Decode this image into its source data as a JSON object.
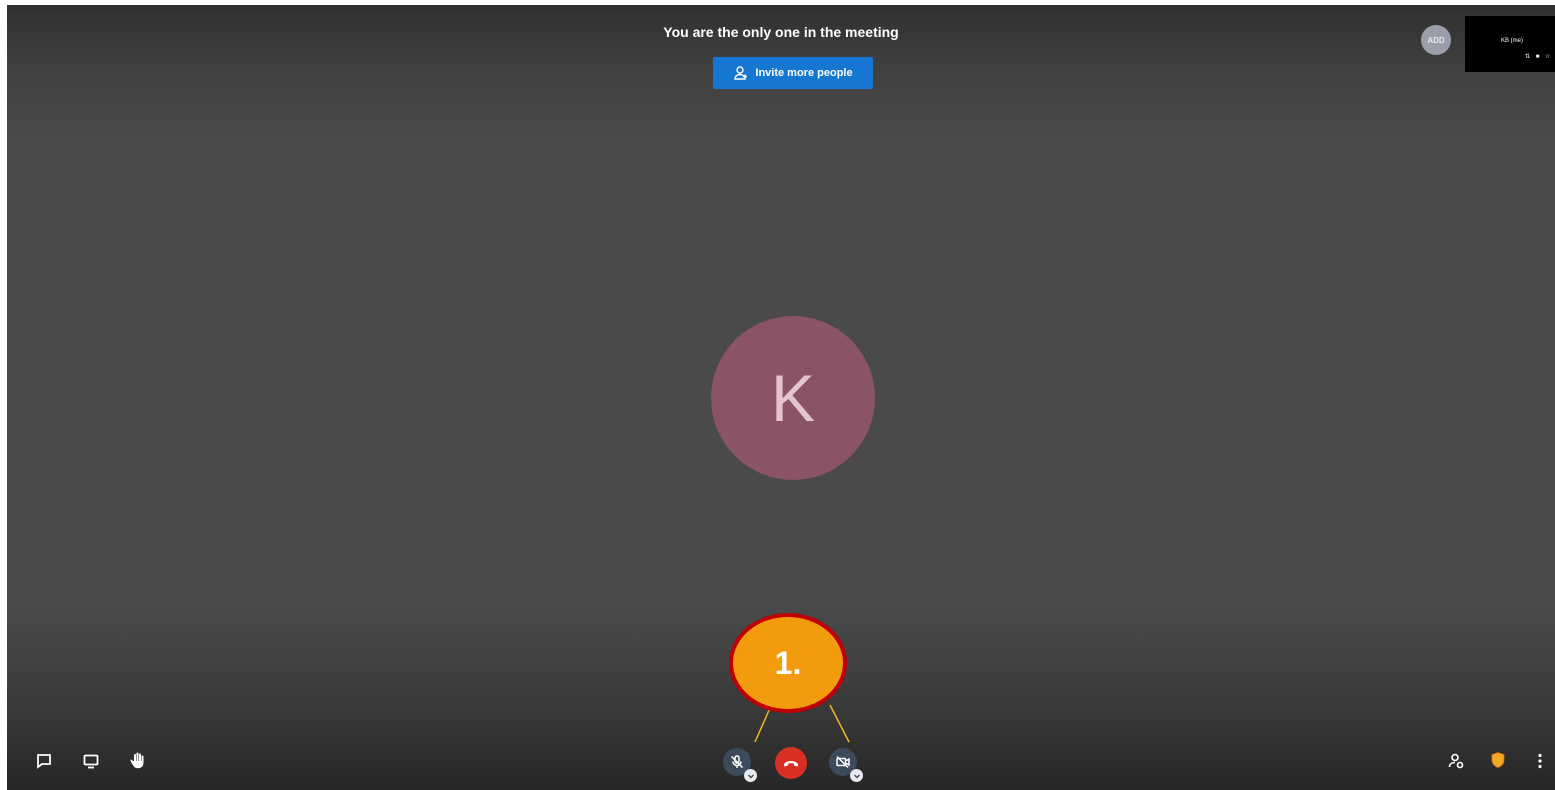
{
  "meeting": {
    "notice": "You are the only one in the meeting",
    "invite_button": "Invite more people"
  },
  "participants": {
    "remote_initials": "ADD",
    "self_tile_name": "KB (me)",
    "main_avatar_initial": "K"
  },
  "annotation": {
    "label": "1.",
    "fill_color": "#f29b0d",
    "border_color": "#c00000"
  },
  "toolbar": {
    "left_icons": [
      "chat-icon",
      "screen-share-icon",
      "raise-hand-icon"
    ],
    "center_controls": [
      "microphone-muted",
      "hang-up",
      "camera-off"
    ],
    "right_icons": [
      "participants-icon",
      "security-shield-icon",
      "more-options-icon"
    ],
    "hangup_color": "#d93025",
    "invite_color": "#1677d2"
  }
}
